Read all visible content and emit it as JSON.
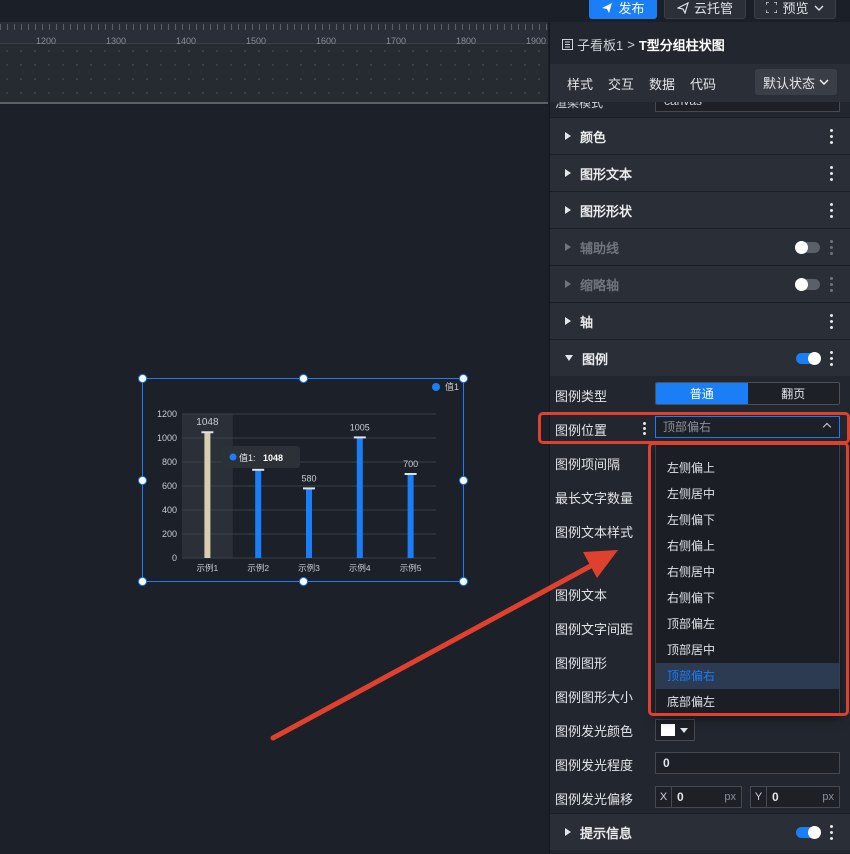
{
  "toolbar": {
    "publish_label": "发布",
    "host_label": "云托管",
    "preview_label": "预览"
  },
  "ruler": {
    "ticks": [
      "1200",
      "1300",
      "1400",
      "1500",
      "1600",
      "1700",
      "1800",
      "1900"
    ]
  },
  "breadcrumb": {
    "parent": "子看板1",
    "separator": ">",
    "current": "T型分组柱状图"
  },
  "panel_tabs": {
    "style": "样式",
    "interaction": "交互",
    "data": "数据",
    "code": "代码",
    "state_select": "默认状态"
  },
  "render_mode": {
    "label": "渲染模式",
    "value": "canvas"
  },
  "sections": {
    "color": "颜色",
    "shape_text": "图形文本",
    "shape_form": "图形形状",
    "guideline": "辅助线",
    "thumb_axis": "缩略轴",
    "axis": "轴",
    "legend": "图例",
    "tooltip": "提示信息"
  },
  "legend_fields": {
    "type_label": "图例类型",
    "type_options": [
      "普通",
      "翻页"
    ],
    "position_label": "图例位置",
    "position_placeholder": "顶部偏右",
    "spacing_label": "图例项间隔",
    "max_text_label": "最长文字数量",
    "text_style_label": "图例文本样式",
    "text_label": "图例文本",
    "text_spacing_label": "图例文字间距",
    "shape_label": "图例图形",
    "shape_size_label": "图例图形大小",
    "glow_color_label": "图例发光颜色",
    "glow_level_label": "图例发光程度",
    "glow_level_value": "0",
    "glow_offset_label": "图例发光偏移",
    "glow_offset_x_axis": "X",
    "glow_offset_x": "0",
    "glow_offset_y_axis": "Y",
    "glow_offset_y": "0",
    "unit": "px"
  },
  "position_options": [
    "左侧偏上",
    "左侧居中",
    "左侧偏下",
    "右侧偏上",
    "右侧居中",
    "右侧偏下",
    "顶部偏左",
    "顶部居中",
    "顶部偏右",
    "底部偏左"
  ],
  "position_selected": "顶部偏右",
  "colors": {
    "accent": "#1a7ef6",
    "highlight_red": "#e0412e",
    "bar_highlight": "#d8ceb0"
  },
  "chart_data": {
    "type": "bar",
    "categories": [
      "示例1",
      "示例2",
      "示例3",
      "示例4",
      "示例5"
    ],
    "series": [
      {
        "name": "值1",
        "values": [
          1048,
          735,
          580,
          1005,
          700
        ]
      }
    ],
    "data_labels": [
      "1048",
      "",
      "580",
      "1005",
      "700"
    ],
    "ylim": [
      0,
      1200
    ],
    "yticks": [
      "0",
      "200",
      "400",
      "600",
      "800",
      "1000",
      "1200"
    ],
    "legend": "top-right",
    "tooltip": {
      "series": "值1:",
      "value": "1048"
    }
  }
}
